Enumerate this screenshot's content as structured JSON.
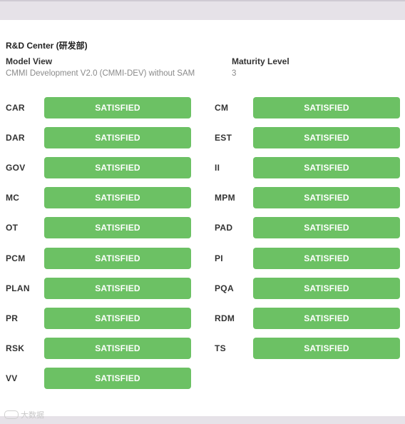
{
  "org": {
    "title": "R&D Center (研发部)"
  },
  "model_view": {
    "label": "Model View",
    "value": "CMMI Development V2.0 (CMMI-DEV) without SAM"
  },
  "maturity": {
    "label": "Maturity Level",
    "value": "3"
  },
  "colors": {
    "satisfied": "#6cc164",
    "background": "#e6e2e8"
  },
  "practice_areas": [
    {
      "code": "CAR",
      "status": "SATISFIED"
    },
    {
      "code": "CM",
      "status": "SATISFIED"
    },
    {
      "code": "DAR",
      "status": "SATISFIED"
    },
    {
      "code": "EST",
      "status": "SATISFIED"
    },
    {
      "code": "GOV",
      "status": "SATISFIED"
    },
    {
      "code": "II",
      "status": "SATISFIED"
    },
    {
      "code": "MC",
      "status": "SATISFIED"
    },
    {
      "code": "MPM",
      "status": "SATISFIED"
    },
    {
      "code": "OT",
      "status": "SATISFIED"
    },
    {
      "code": "PAD",
      "status": "SATISFIED"
    },
    {
      "code": "PCM",
      "status": "SATISFIED"
    },
    {
      "code": "PI",
      "status": "SATISFIED"
    },
    {
      "code": "PLAN",
      "status": "SATISFIED"
    },
    {
      "code": "PQA",
      "status": "SATISFIED"
    },
    {
      "code": "PR",
      "status": "SATISFIED"
    },
    {
      "code": "RDM",
      "status": "SATISFIED"
    },
    {
      "code": "RSK",
      "status": "SATISFIED"
    },
    {
      "code": "TS",
      "status": "SATISFIED"
    },
    {
      "code": "VV",
      "status": "SATISFIED"
    }
  ],
  "watermark": "大数据"
}
